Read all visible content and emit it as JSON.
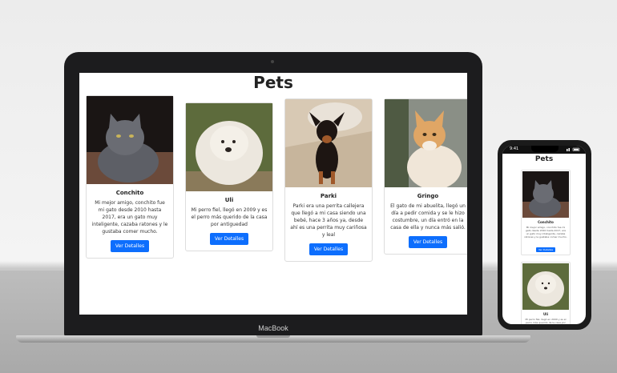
{
  "laptop": {
    "brand": "MacBook",
    "title": "Pets",
    "cards": [
      {
        "name": "Conchito",
        "description": "Mi mejor amigo, conchito fue mi gato desde 2010 hasta 2017, era un gato muy inteligente, cazaba ratones y le gustaba comer mucho.",
        "button": "Ver Detalles"
      },
      {
        "name": "Uli",
        "description": "Mi perro fiel, llegó en 2009 y es el perro más querido de la casa por antiguedad",
        "button": "Ver Detalles"
      },
      {
        "name": "Parki",
        "description": "Parki era una perrita callejera que llegó a mi casa siendo una bebé, hace 3 años ya, desde ahí es una perrita muy cariñosa y leal",
        "button": "Ver Detalles"
      },
      {
        "name": "Gringo",
        "description": "El gato de mi abuelita, llegó un día a pedir comida y se le hizo costumbre, un día entró en la casa de ella y nunca más salió.",
        "button": "Ver Detalles"
      }
    ]
  },
  "phone": {
    "time": "9:41",
    "title": "Pets",
    "cards": [
      {
        "name": "Conchito",
        "description": "Mi mejor amigo, conchito fue mi gato desde 2010 hasta 2017, era un gato muy inteligente, cazaba ratones y le gustaba comer mucho.",
        "button": "Ver Detalles"
      },
      {
        "name": "Uli",
        "description": "Mi perro fiel, llegó en 2009 y es el perro más querido de la casa por"
      }
    ]
  },
  "colors": {
    "button": "#0d6efd",
    "laptop_frame": "#1c1c1e",
    "phone_frame": "#1b1b1b"
  },
  "icons": [
    "camera-icon",
    "signal-icon",
    "wifi-icon",
    "battery-icon"
  ]
}
